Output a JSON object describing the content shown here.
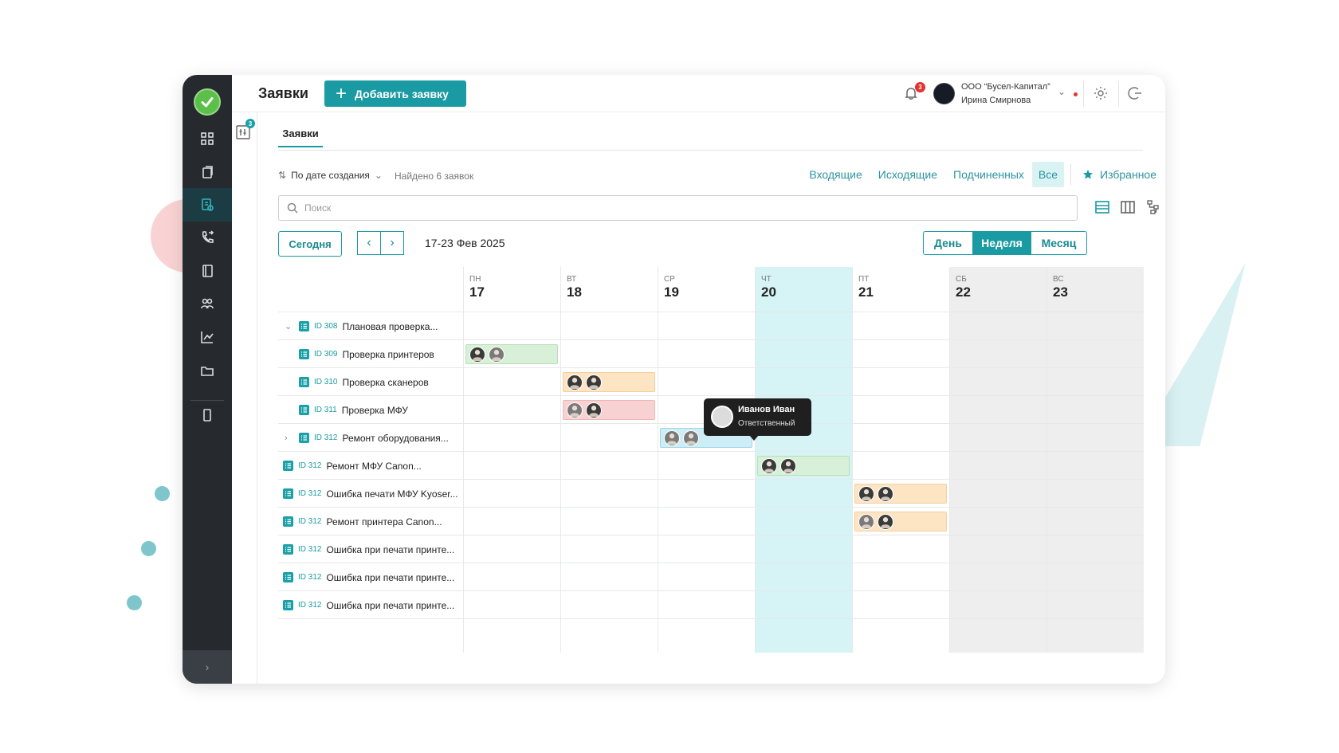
{
  "header": {
    "page_title": "Заявки",
    "add_button": "Добавить заявку",
    "notifications_count": "3",
    "org_name": "ООО “Бусел-Капитал”",
    "user_name": "Ирина Смирнова",
    "filter_count": "3"
  },
  "tabs": [
    {
      "label": "Заявки",
      "active": true
    }
  ],
  "toolbar": {
    "sort_label": "По дате создания",
    "found_text": "Найдено 6 заявок",
    "filters": [
      "Входящие",
      "Исходящие",
      "Подчиненных",
      "Все"
    ],
    "active_filter": "Все",
    "favorite": "Избранное",
    "search_placeholder": "Поиск"
  },
  "calendar": {
    "today_button": "Сегодня",
    "date_range": "17-23 Фев 2025",
    "views": [
      "День",
      "Неделя",
      "Месяц"
    ],
    "active_view": "Неделя",
    "days": [
      {
        "name": "ПН",
        "num": "17",
        "type": "normal"
      },
      {
        "name": "ВТ",
        "num": "18",
        "type": "normal"
      },
      {
        "name": "СР",
        "num": "19",
        "type": "normal"
      },
      {
        "name": "ЧТ",
        "num": "20",
        "type": "today"
      },
      {
        "name": "ПТ",
        "num": "21",
        "type": "normal"
      },
      {
        "name": "СБ",
        "num": "22",
        "type": "weekend"
      },
      {
        "name": "ВС",
        "num": "23",
        "type": "weekend"
      }
    ],
    "rows": [
      {
        "id": "ID 308",
        "title": "Плановая проверка...",
        "level": 1,
        "expander": "down"
      },
      {
        "id": "ID 309",
        "title": "Проверка принтеров",
        "level": 1,
        "expander": "none",
        "bar": {
          "day": 0,
          "color": "green",
          "avatars": [
            "dark",
            "grey"
          ]
        }
      },
      {
        "id": "ID 310",
        "title": "Проверка сканеров",
        "level": 1,
        "expander": "none",
        "bar": {
          "day": 1,
          "color": "orange",
          "avatars": [
            "dark",
            "dark"
          ]
        }
      },
      {
        "id": "ID 311",
        "title": "Проверка МФУ",
        "level": 1,
        "expander": "none",
        "bar": {
          "day": 1,
          "color": "red",
          "avatars": [
            "grey",
            "dark"
          ]
        }
      },
      {
        "id": "ID 312",
        "title": "Ремонт оборудования...",
        "level": 1,
        "expander": "right",
        "bar": {
          "day": 2,
          "color": "blue",
          "avatars": [
            "grey",
            "grey"
          ]
        }
      },
      {
        "id": "ID 312",
        "title": "Ремонт МФУ Canon...",
        "level": 0,
        "expander": "none",
        "bar": {
          "day": 3,
          "color": "green",
          "avatars": [
            "dark",
            "dark"
          ]
        }
      },
      {
        "id": "ID 312",
        "title": "Ошибка печати МФУ Kyoser...",
        "level": 0,
        "expander": "none",
        "bar": {
          "day": 4,
          "color": "orange",
          "avatars": [
            "dark",
            "dark"
          ]
        }
      },
      {
        "id": "ID 312",
        "title": "Ремонт принтера Canon...",
        "level": 0,
        "expander": "none",
        "bar": {
          "day": 4,
          "color": "orange",
          "avatars": [
            "grey",
            "dark"
          ]
        }
      },
      {
        "id": "ID 312",
        "title": "Ошибка при печати принте...",
        "level": 0,
        "expander": "none"
      },
      {
        "id": "ID 312",
        "title": "Ошибка при печати принте...",
        "level": 0,
        "expander": "none"
      },
      {
        "id": "ID 312",
        "title": "Ошибка при печати принте...",
        "level": 0,
        "expander": "none"
      }
    ],
    "tooltip": {
      "name": "Иванов Иван",
      "role": "Ответственный"
    }
  },
  "colors": {
    "accent": "#1a9aa2",
    "sidebar": "#262a2e",
    "today": "#d6f3f5",
    "weekend": "#eeeeee"
  }
}
